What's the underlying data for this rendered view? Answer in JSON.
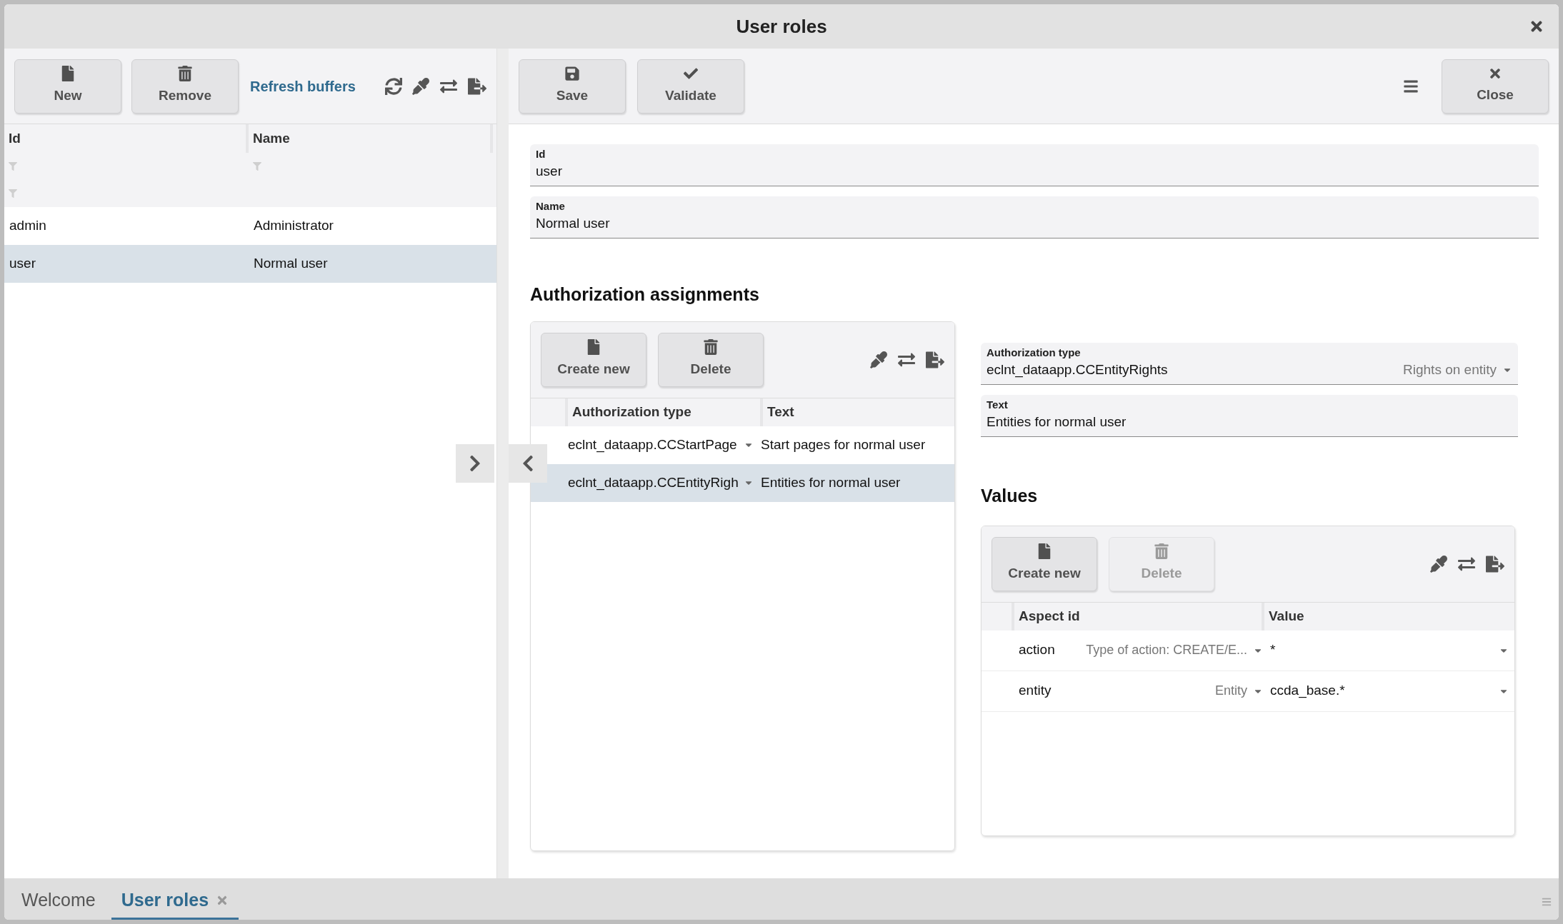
{
  "window": {
    "title": "User roles"
  },
  "left_toolbar": {
    "buttons": [
      {
        "label": "New",
        "disabled": false
      },
      {
        "label": "Remove",
        "disabled": false
      }
    ],
    "link": "Refresh buffers"
  },
  "roles_table": {
    "columns": [
      "Id",
      "Name"
    ],
    "rows": [
      {
        "id": "admin",
        "name": "Administrator",
        "selected": false
      },
      {
        "id": "user",
        "name": "Normal user",
        "selected": true
      }
    ]
  },
  "right_toolbar": {
    "buttons": [
      {
        "label": "Save",
        "disabled": false
      },
      {
        "label": "Validate",
        "disabled": false
      }
    ],
    "close_button": "Close"
  },
  "form": {
    "fields": [
      {
        "label": "Id",
        "value": "user"
      },
      {
        "label": "Name",
        "value": "Normal user"
      }
    ]
  },
  "assignments": {
    "heading": "Authorization assignments",
    "buttons": [
      {
        "label": "Create new",
        "disabled": false
      },
      {
        "label": "Delete",
        "disabled": false
      }
    ],
    "columns": [
      "Authorization type",
      "Text"
    ],
    "rows": [
      {
        "type": "eclnt_dataapp.CCStartPage",
        "text": "Start pages for normal user",
        "selected": false
      },
      {
        "type": "eclnt_dataapp.CCEntityRigh",
        "text": "Entities for normal user",
        "selected": true
      }
    ]
  },
  "detail": {
    "type_field": {
      "label": "Authorization type",
      "value": "eclnt_dataapp.CCEntityRights",
      "hint": "Rights on entity"
    },
    "text_field": {
      "label": "Text",
      "value": "Entities for normal user"
    }
  },
  "values": {
    "heading": "Values",
    "buttons": [
      {
        "label": "Create new",
        "disabled": false
      },
      {
        "label": "Delete",
        "disabled": true
      }
    ],
    "columns": [
      "Aspect id",
      "Value"
    ],
    "rows": [
      {
        "aspect_id": "action",
        "hint": "Type of action: CREATE/E...",
        "value": "*"
      },
      {
        "aspect_id": "entity",
        "hint": "Entity",
        "value": "ccda_base.*"
      }
    ]
  },
  "bottom_tabs": [
    {
      "label": "Welcome",
      "selected": false,
      "closable": false
    },
    {
      "label": "User roles",
      "selected": true,
      "closable": true
    }
  ]
}
